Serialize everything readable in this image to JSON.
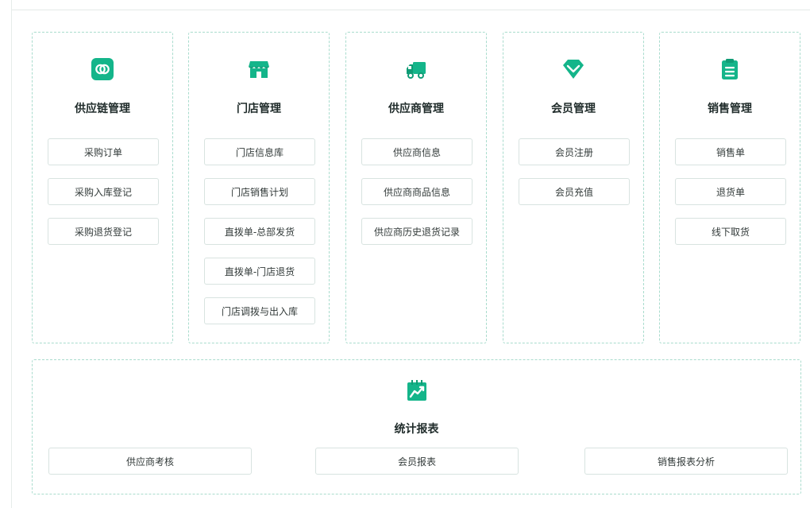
{
  "colors": {
    "accent": "#14b58a",
    "accent_dark": "#0f9c75",
    "canvas": "#f2f8f7",
    "border": "#a9dccd"
  },
  "modules": [
    {
      "title": "供应链管理",
      "icon": "link-ring-icon",
      "items": [
        "采购订单",
        "采购入库登记",
        "采购退货登记"
      ]
    },
    {
      "title": "门店管理",
      "icon": "store-icon",
      "items": [
        "门店信息库",
        "门店销售计划",
        "直拨单-总部发货",
        "直拨单-门店退货",
        "门店调拨与出入库"
      ]
    },
    {
      "title": "供应商管理",
      "icon": "truck-icon",
      "items": [
        "供应商信息",
        "供应商商品信息",
        "供应商历史退货记录"
      ]
    },
    {
      "title": "会员管理",
      "icon": "diamond-icon",
      "items": [
        "会员注册",
        "会员充值"
      ]
    },
    {
      "title": "销售管理",
      "icon": "clipboard-icon",
      "items": [
        "销售单",
        "退货单",
        "线下取货"
      ]
    }
  ],
  "report": {
    "title": "统计报表",
    "icon": "trend-chart-icon",
    "items": [
      "供应商考核",
      "会员报表",
      "销售报表分析"
    ]
  }
}
